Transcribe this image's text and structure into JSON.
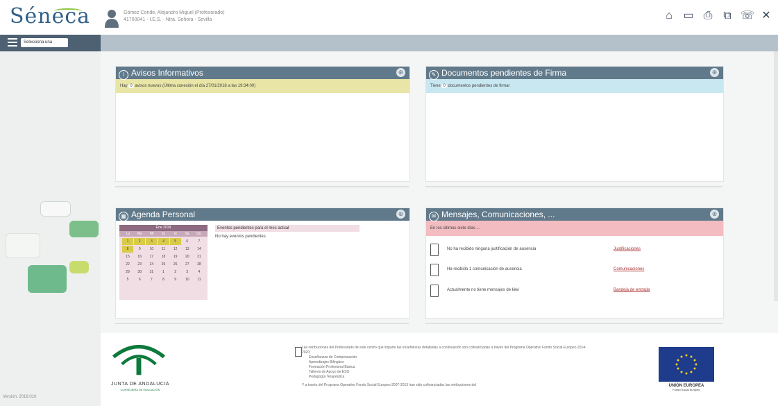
{
  "header": {
    "logo_text": "Séneca",
    "user_name": "Gómez Conde, Alejandro Miguel (Profesorado)",
    "user_center": "41700041 - I.E.S. - Ntra. Señora - Sevilla",
    "icons": [
      "home-icon",
      "folder-icon",
      "print-icon",
      "copy-icon",
      "phone-icon",
      "close-icon"
    ]
  },
  "menubar": {
    "select_label": "Selecciona una"
  },
  "sidebar": {
    "version": "Versión: 2018.010"
  },
  "avisos": {
    "title": "Avisos Informativos",
    "bar_prefix": "Hay",
    "count": "0",
    "bar_suffix": "avisos nuevos (Última conexión el día 27/01/2018 a las 19:34:00)"
  },
  "documentos": {
    "title": "Documentos pendientes de Firma",
    "bar_prefix": "Tiene",
    "count": "0",
    "bar_suffix": "documentos pendientes de firmar"
  },
  "agenda": {
    "title": "Agenda Personal",
    "calendar_month": "Ene 2018",
    "weekdays": [
      "Lu",
      "Ma",
      "Mi",
      "Ju",
      "Vi",
      "Sa",
      "Do"
    ],
    "days": [
      "1",
      "2",
      "3",
      "4",
      "5",
      "6",
      "7",
      "8",
      "9",
      "10",
      "11",
      "12",
      "13",
      "14",
      "15",
      "16",
      "17",
      "18",
      "19",
      "20",
      "21",
      "22",
      "23",
      "24",
      "25",
      "26",
      "27",
      "28",
      "29",
      "30",
      "31",
      "1",
      "2",
      "3",
      "4",
      "5",
      "6",
      "7",
      "8",
      "9",
      "10",
      "11"
    ],
    "events_title": "Eventos pendientes para el mes actual",
    "events_empty": "No hay eventos pendientes"
  },
  "mensajes": {
    "title": "Mensajes, Comunicaciones, ...",
    "alert": "En los últimos siete días ...",
    "rows": [
      {
        "text": "No ha recibido ninguna justificación de ausencia",
        "link": "Justificaciones"
      },
      {
        "text": "Ha recibido 1 comunicación de ausencia",
        "link": "Comunicaciones"
      },
      {
        "text": "Actualmente no tiene mensajes de kiwi",
        "link": "Bandeja de entrada"
      }
    ]
  },
  "footer": {
    "junta_line1": "JUNTA DE ANDALUCIA",
    "junta_line2": "CONSEJERÍA DE EDUCACIÓN",
    "fund_intro": "Las retribuciones del Profesorado de este centro que imparte las enseñanzas detalladas a continuación son cofinanciadas a través del Programa Operativo Fondo Social Europeo 2014-2020:",
    "fund_items": [
      "Enseñanzas de Compensación",
      "Aprendizajes Bilingües",
      "Formación Profesional Básica",
      "Talleres de Apoyo de ESO",
      "Pedagogía Terapéutica"
    ],
    "fund_outro": "Y a través del Programa Operativo Fondo Social Europeo 2007-2013 han sido cofinanciadas las retribuciones del",
    "eu_label": "UNIÓN EUROPEA",
    "eu_sublabel": "Fondo Social Europeo"
  }
}
